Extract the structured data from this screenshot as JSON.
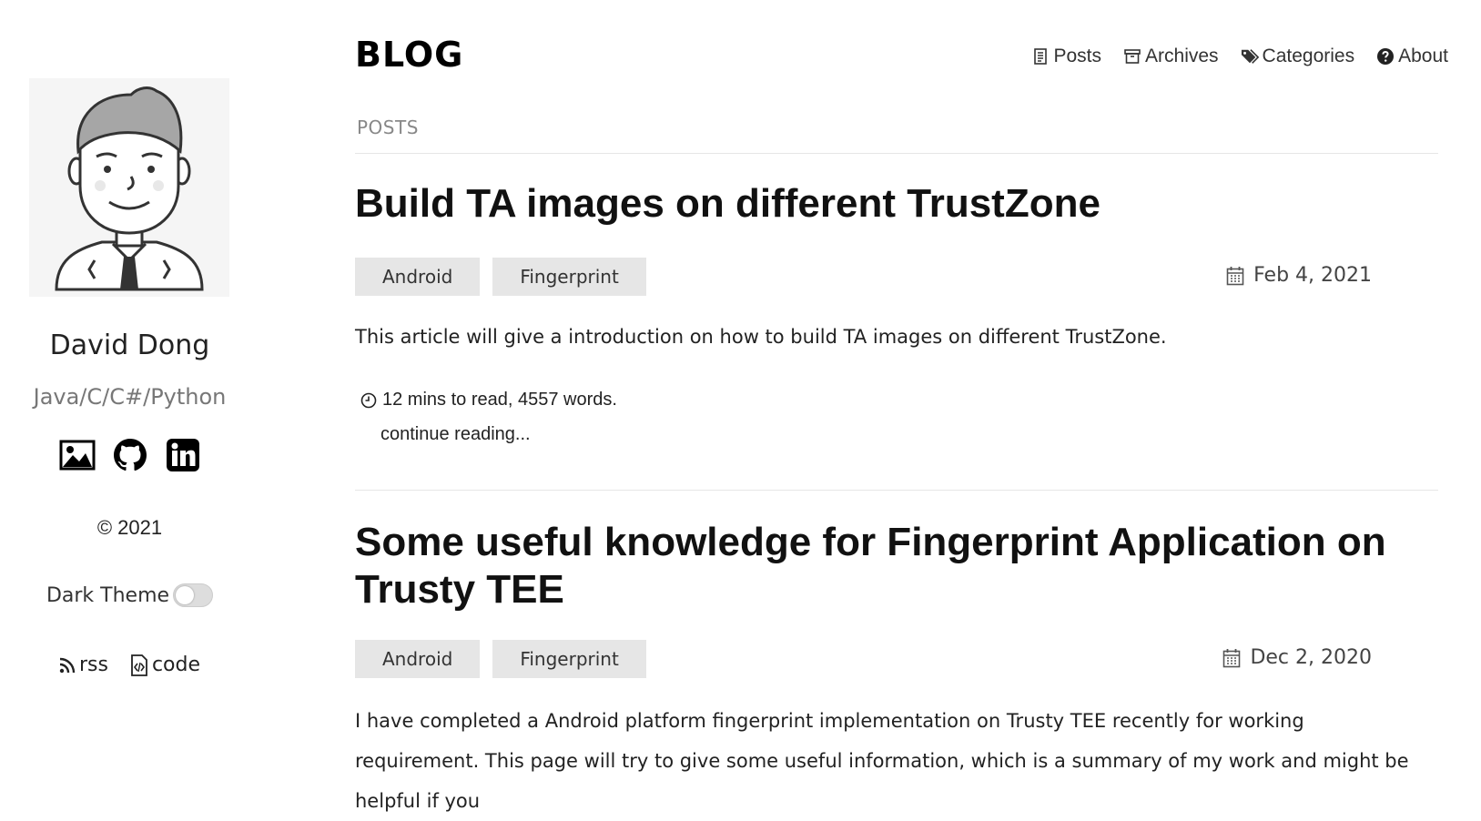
{
  "sidebar": {
    "author_name": "David Dong",
    "author_subtitle": "Java/C/C#/Python",
    "social_icons": [
      "image-icon",
      "github-icon",
      "linkedin-icon"
    ],
    "copyright": "© 2021",
    "dark_theme_label": "Dark Theme",
    "dark_theme_on": false,
    "links": [
      {
        "label": "rss",
        "icon": "rss-icon"
      },
      {
        "label": "code",
        "icon": "code-file-icon"
      }
    ]
  },
  "header": {
    "brand": "BLOG",
    "nav": [
      {
        "label": "Posts",
        "icon": "document-icon"
      },
      {
        "label": "Archives",
        "icon": "archive-icon"
      },
      {
        "label": "Categories",
        "icon": "tags-icon"
      },
      {
        "label": "About",
        "icon": "question-circle-icon"
      }
    ]
  },
  "main": {
    "section_label": "POSTS",
    "posts": [
      {
        "title": "Build TA images on different TrustZone",
        "tags": [
          "Android",
          "Fingerprint"
        ],
        "date": "Feb 4, 2021",
        "excerpt": "This article will give a introduction on how to build TA images on different TrustZone.",
        "read_info": "12 mins to read, 4557 words.",
        "continue_label": "continue reading..."
      },
      {
        "title": "Some useful knowledge for Fingerprint Application on Trusty TEE",
        "tags": [
          "Android",
          "Fingerprint"
        ],
        "date": "Dec 2, 2020",
        "excerpt": "I have completed a Android platform fingerprint implementation on Trusty TEE recently for working requirement. This page will try to give some useful information, which is a summary of my work and might be helpful if you"
      }
    ]
  },
  "colors": {
    "tag_background": "#e6e6e6",
    "muted_text": "#888888",
    "divider": "#e6e6e6"
  }
}
